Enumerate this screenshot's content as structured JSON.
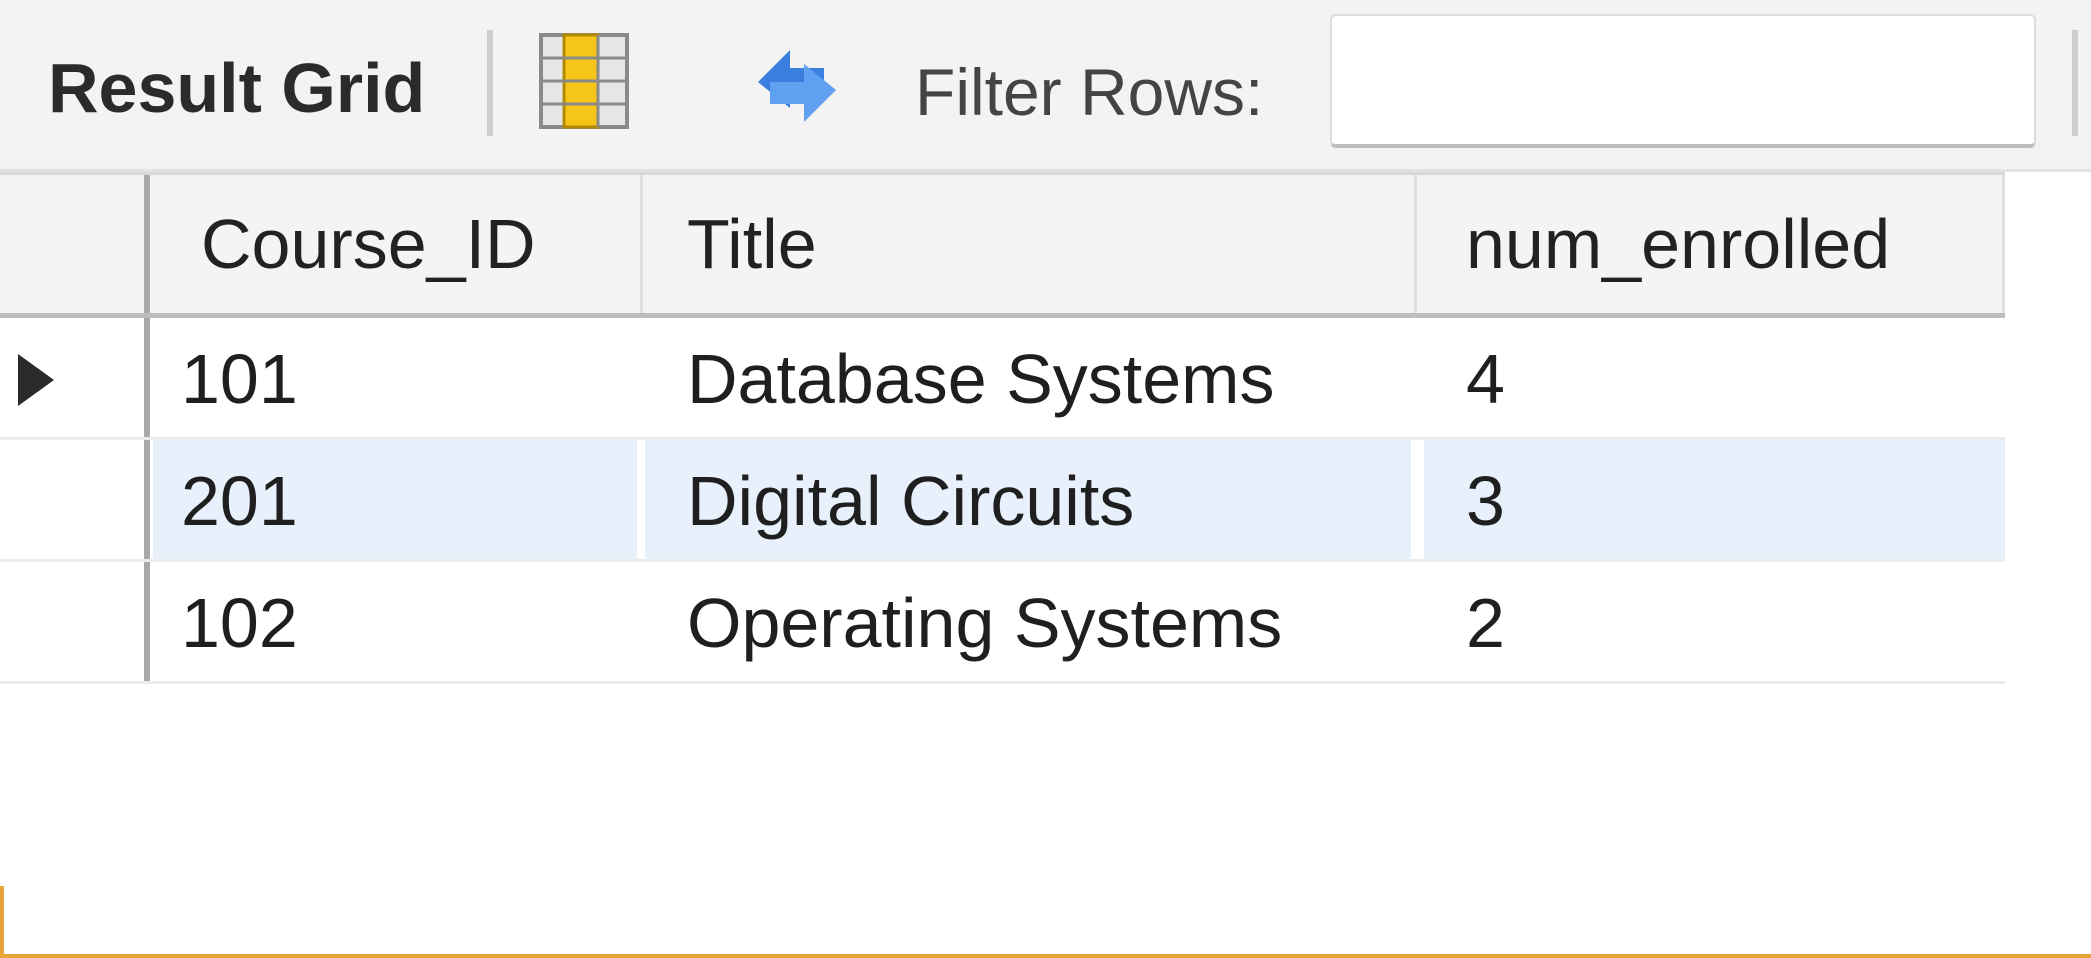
{
  "toolbar": {
    "title": "Result Grid",
    "filter_label": "Filter Rows:",
    "filter_value": "",
    "icons": {
      "grid": "form-grid-icon",
      "refresh": "refresh-icon"
    },
    "colors": {
      "grid_icon_fill": "#f5c518",
      "refresh_icon": "#3a7fe0"
    }
  },
  "grid": {
    "columns": [
      "Course_ID",
      "Title",
      "num_enrolled"
    ],
    "rows": [
      {
        "Course_ID": "101",
        "Title": "Database Systems",
        "num_enrolled": "4",
        "current": true
      },
      {
        "Course_ID": "201",
        "Title": "Digital Circuits",
        "num_enrolled": "3",
        "current": false
      },
      {
        "Course_ID": "102",
        "Title": "Operating Systems",
        "num_enrolled": "2",
        "current": false
      }
    ],
    "colors": {
      "alt_row_bg": "#e8f0fc",
      "header_bg": "#f4f4f4"
    }
  }
}
